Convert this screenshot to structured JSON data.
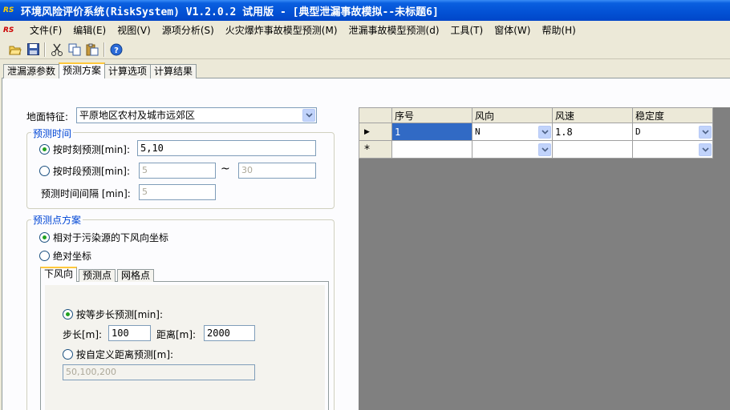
{
  "window": {
    "title": "环境风险评价系统(RiskSystem) V1.2.0.2 试用版 - [典型泄漏事故模拟--未标题6]",
    "app_icon": "RS"
  },
  "menu": {
    "items": [
      "文件(F)",
      "编辑(E)",
      "视图(V)",
      "源项分析(S)",
      "火灾爆炸事故模型预测(M)",
      "泄漏事故模型预测(d)",
      "工具(T)",
      "窗体(W)",
      "帮助(H)"
    ]
  },
  "toolbar": {
    "icons": [
      "open-folder-icon",
      "save-icon",
      "cut-icon",
      "copy-icon",
      "paste-icon",
      "help-icon"
    ]
  },
  "tabs": [
    "泄漏源参数",
    "预测方案",
    "计算选项",
    "计算结果"
  ],
  "active_tab": "预测方案",
  "form": {
    "terrain_label": "地面特征:",
    "terrain_value": "平原地区农村及城市远郊区",
    "time_group_title": "预测时间",
    "by_time_label": "按时刻预测[min]:",
    "by_time_value": "5,10",
    "by_period_label": "按时段预测[min]:",
    "period_start_placeholder": "5",
    "period_sep": "~",
    "period_end_placeholder": "30",
    "interval_label": "预测时间间隔 [min]:",
    "interval_placeholder": "5",
    "point_group_title": "预测点方案",
    "relative_label": "相对于污染源的下风向坐标",
    "absolute_label": "绝对坐标",
    "inner_tabs": [
      "下风向",
      "预测点",
      "网格点"
    ],
    "step_radio_label": "按等步长预测[min]:",
    "step_label": "步长[m]:",
    "step_value": "100",
    "distance_label": "距离[m]:",
    "distance_value": "2000",
    "custom_radio_label": "按自定义距离预测[m]:",
    "custom_placeholder": "50,100,200"
  },
  "grid": {
    "columns": [
      "序号",
      "风向",
      "风速",
      "稳定度"
    ],
    "rows": [
      {
        "marker": "▶",
        "index": "1",
        "direction": "N",
        "speed": "1.8",
        "stability": "D"
      },
      {
        "marker": "*",
        "index": "",
        "direction": "",
        "speed": "",
        "stability": ""
      }
    ]
  },
  "colors": {
    "title_bar": "#0351d4",
    "group_title": "#0046d5",
    "tab_highlight": "#ffc83c",
    "grid_bg": "#808080",
    "selected_cell": "#316ac5"
  }
}
